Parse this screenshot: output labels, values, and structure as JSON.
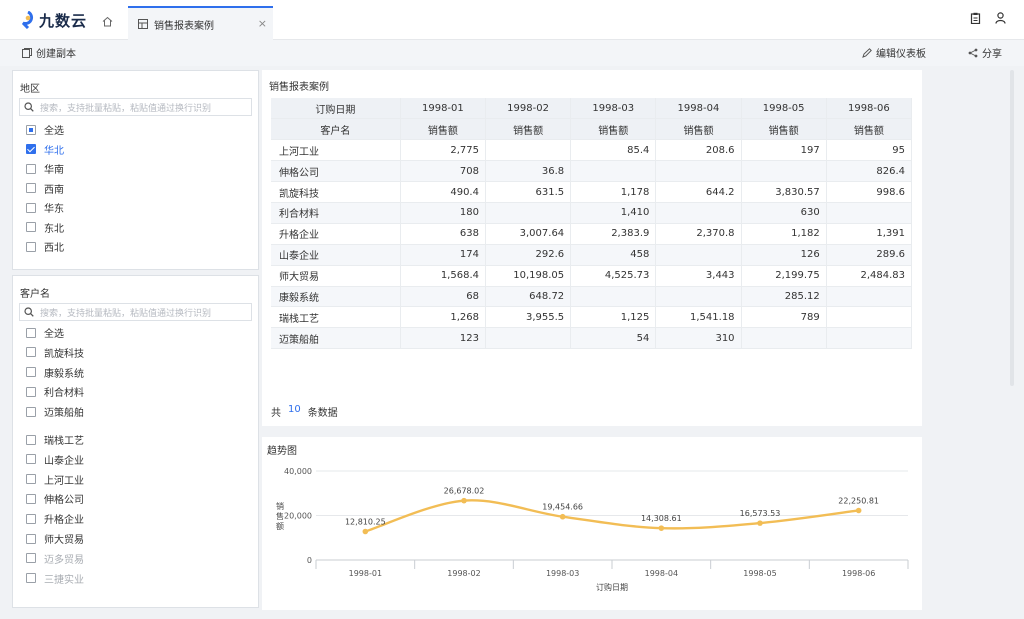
{
  "app": {
    "logo_text": "九数云"
  },
  "tabs": {
    "active_label": "销售报表案例",
    "close": "×"
  },
  "toolbar": {
    "copy_label": "创建副本",
    "edit_label": "编辑仪表板",
    "share_label": "分享"
  },
  "region_filter": {
    "title": "地区",
    "placeholder": "搜索，支持批量粘贴，粘贴值通过换行识别",
    "options": [
      {
        "label": "全选",
        "state": "indeterminate"
      },
      {
        "label": "华北",
        "state": "checked"
      },
      {
        "label": "华南",
        "state": "unchecked"
      },
      {
        "label": "西南",
        "state": "unchecked"
      },
      {
        "label": "华东",
        "state": "unchecked"
      },
      {
        "label": "东北",
        "state": "unchecked"
      },
      {
        "label": "西北",
        "state": "unchecked"
      }
    ]
  },
  "customer_filter": {
    "title": "客户名",
    "placeholder": "搜索，支持批量粘贴，粘贴值通过换行识别",
    "options": [
      {
        "label": "全选"
      },
      {
        "label": "凯旋科技"
      },
      {
        "label": "康毅系统"
      },
      {
        "label": "利合材料"
      },
      {
        "label": "迈策船舶"
      },
      {
        "label": "瑞栈工艺"
      },
      {
        "label": "山泰企业"
      },
      {
        "label": "上河工业"
      },
      {
        "label": "伸格公司"
      },
      {
        "label": "升格企业"
      },
      {
        "label": "师大贸易"
      },
      {
        "label": "迈多贸易"
      },
      {
        "label": "三捷实业"
      }
    ]
  },
  "table": {
    "title": "销售报表案例",
    "header_row1_label": "订购日期",
    "header_row2_label": "客户名",
    "months": [
      "1998-01",
      "1998-02",
      "1998-03",
      "1998-04",
      "1998-05",
      "1998-06"
    ],
    "measure_label": "销售额",
    "rows": [
      {
        "name": "上河工业",
        "values": [
          "2,775",
          "",
          "85.4",
          "208.6",
          "197",
          "95"
        ]
      },
      {
        "name": "伸格公司",
        "values": [
          "708",
          "36.8",
          "",
          "",
          "",
          "826.4"
        ]
      },
      {
        "name": "凯旋科技",
        "values": [
          "490.4",
          "631.5",
          "1,178",
          "644.2",
          "3,830.57",
          "998.6"
        ]
      },
      {
        "name": "利合材料",
        "values": [
          "180",
          "",
          "1,410",
          "",
          "630",
          ""
        ]
      },
      {
        "name": "升格企业",
        "values": [
          "638",
          "3,007.64",
          "2,383.9",
          "2,370.8",
          "1,182",
          "1,391"
        ]
      },
      {
        "name": "山泰企业",
        "values": [
          "174",
          "292.6",
          "458",
          "",
          "126",
          "289.6"
        ]
      },
      {
        "name": "师大贸易",
        "values": [
          "1,568.4",
          "10,198.05",
          "4,525.73",
          "3,443",
          "2,199.75",
          "2,484.83"
        ]
      },
      {
        "name": "康毅系统",
        "values": [
          "68",
          "648.72",
          "",
          "",
          "285.12",
          ""
        ]
      },
      {
        "name": "瑞栈工艺",
        "values": [
          "1,268",
          "3,955.5",
          "1,125",
          "1,541.18",
          "789",
          ""
        ]
      },
      {
        "name": "迈策船舶",
        "values": [
          "123",
          "",
          "54",
          "310",
          "",
          ""
        ]
      }
    ],
    "total_prefix": "共",
    "total_count": "10",
    "total_suffix": "条数据"
  },
  "chart": {
    "title": "趋势图"
  },
  "chart_data": {
    "type": "line",
    "title": "趋势图",
    "xlabel": "订购日期",
    "ylabel": "销售额",
    "categories": [
      "1998-01",
      "1998-02",
      "1998-03",
      "1998-04",
      "1998-05",
      "1998-06"
    ],
    "series": [
      {
        "values": [
          12810.25,
          26678.02,
          19454.66,
          14308.61,
          16573.53,
          22250.81
        ]
      }
    ],
    "data_labels": [
      "12,810.25",
      "26,678.02",
      "19,454.66",
      "14,308.61",
      "16,573.53",
      "22,250.81"
    ],
    "yticks": [
      "40,000",
      "20,000",
      "0"
    ],
    "ylim": [
      0,
      40000
    ],
    "grid": true,
    "line_color": "#f2bd55"
  }
}
